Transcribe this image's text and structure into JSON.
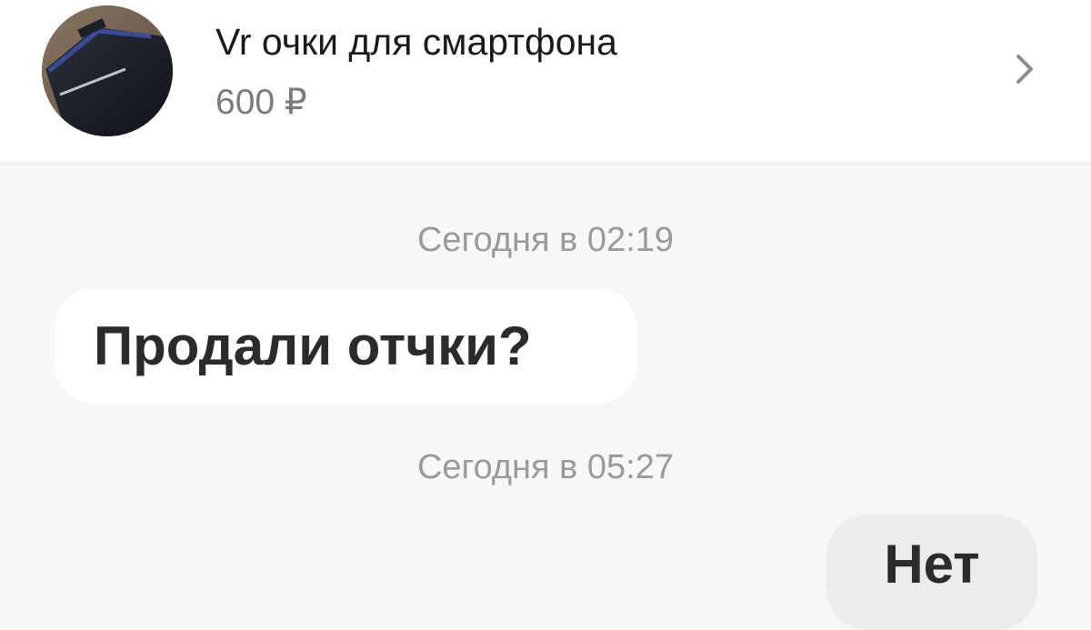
{
  "item": {
    "title": "Vr очки для смартфона",
    "price": "600 ₽",
    "thumbnail_icon": "vr-headset-photo",
    "open_icon": "chevron-right-icon"
  },
  "messages": [
    {
      "timestamp": "Сегодня в 02:19",
      "text": "Продали отчки?",
      "direction": "incoming"
    },
    {
      "timestamp": "Сегодня в 05:27",
      "text": "Нет",
      "direction": "outgoing"
    }
  ],
  "colors": {
    "background": "#f7f7f7",
    "bubble_incoming": "#ffffff",
    "bubble_outgoing": "#ececec",
    "timestamp": "#9a9a9a",
    "price": "#7b7b7b"
  }
}
